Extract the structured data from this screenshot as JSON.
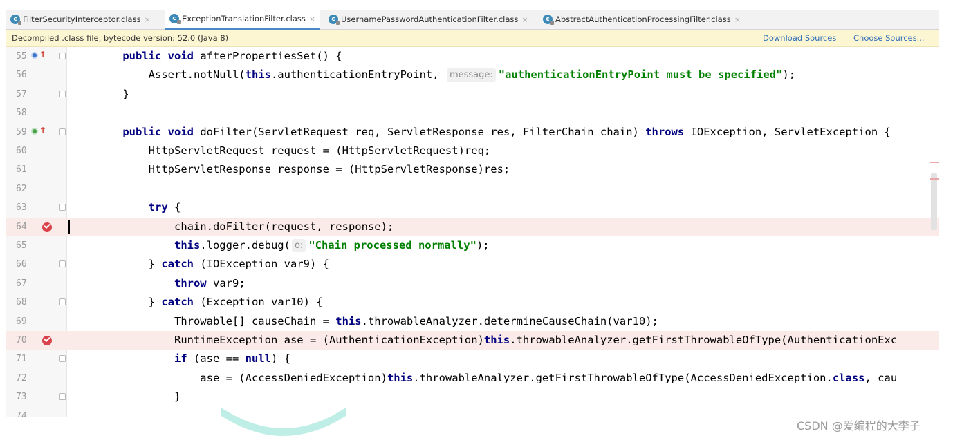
{
  "tabs": [
    {
      "label": "FilterSecurityInterceptor.class",
      "active": false
    },
    {
      "label": "ExceptionTranslationFilter.class",
      "active": true
    },
    {
      "label": "UsernamePasswordAuthenticationFilter.class",
      "active": false
    },
    {
      "label": "AbstractAuthenticationProcessingFilter.class",
      "active": false
    }
  ],
  "tab_icon_letter": "c",
  "close_glyph": "×",
  "banner": {
    "text": "Decompiled .class file, bytecode version: 52.0 (Java 8)",
    "download_link": "Download Sources",
    "choose_link": "Choose Sources..."
  },
  "code_lines": [
    {
      "n": "55",
      "marker": "override-blue",
      "tokens": [
        {
          "t": "    "
        },
        {
          "t": "public void",
          "c": "kw"
        },
        {
          "t": " afterPropertiesSet() {"
        }
      ]
    },
    {
      "n": "56",
      "tokens": [
        {
          "t": "        Assert.notNull("
        },
        {
          "t": "this",
          "c": "kw"
        },
        {
          "t": ".authenticationEntryPoint, "
        },
        {
          "t": "message:",
          "c": "hint"
        },
        {
          "t": "\"authenticationEntryPoint must be specified\"",
          "c": "str"
        },
        {
          "t": ");"
        }
      ]
    },
    {
      "n": "57",
      "tokens": [
        {
          "t": "    }"
        }
      ]
    },
    {
      "n": "58",
      "tokens": []
    },
    {
      "n": "59",
      "marker": "override-green",
      "tokens": [
        {
          "t": "    "
        },
        {
          "t": "public void",
          "c": "kw"
        },
        {
          "t": " doFilter(ServletRequest req, ServletResponse res, FilterChain chain) "
        },
        {
          "t": "throws",
          "c": "kw"
        },
        {
          "t": " IOException, ServletException {"
        }
      ]
    },
    {
      "n": "60",
      "tokens": [
        {
          "t": "        HttpServletRequest request = (HttpServletRequest)req;"
        }
      ]
    },
    {
      "n": "61",
      "tokens": [
        {
          "t": "        HttpServletResponse response = (HttpServletResponse)res;"
        }
      ]
    },
    {
      "n": "62",
      "tokens": []
    },
    {
      "n": "63",
      "tokens": [
        {
          "t": "        "
        },
        {
          "t": "try",
          "c": "kw"
        },
        {
          "t": " {"
        }
      ]
    },
    {
      "n": "64",
      "marker": "breakpoint",
      "highlight": true,
      "caret": true,
      "tokens": [
        {
          "t": "            chain.doFilter(request, response);"
        }
      ]
    },
    {
      "n": "65",
      "tokens": [
        {
          "t": "            "
        },
        {
          "t": "this",
          "c": "kw"
        },
        {
          "t": ".logger.debug("
        },
        {
          "t": "o:",
          "c": "hint"
        },
        {
          "t": "\"Chain processed normally\"",
          "c": "str"
        },
        {
          "t": ");"
        }
      ]
    },
    {
      "n": "66",
      "tokens": [
        {
          "t": "        } "
        },
        {
          "t": "catch",
          "c": "kw"
        },
        {
          "t": " (IOException var9) {"
        }
      ]
    },
    {
      "n": "67",
      "tokens": [
        {
          "t": "            "
        },
        {
          "t": "throw",
          "c": "kw"
        },
        {
          "t": " var9;"
        }
      ]
    },
    {
      "n": "68",
      "tokens": [
        {
          "t": "        } "
        },
        {
          "t": "catch",
          "c": "kw"
        },
        {
          "t": " (Exception var10) {"
        }
      ]
    },
    {
      "n": "69",
      "tokens": [
        {
          "t": "            Throwable[] causeChain = "
        },
        {
          "t": "this",
          "c": "kw"
        },
        {
          "t": ".throwableAnalyzer.determineCauseChain(var10);"
        }
      ]
    },
    {
      "n": "70",
      "marker": "breakpoint",
      "highlight": true,
      "tokens": [
        {
          "t": "            RuntimeException ase = (AuthenticationException)"
        },
        {
          "t": "this",
          "c": "kw"
        },
        {
          "t": ".throwableAnalyzer.getFirstThrowableOfType(AuthenticationExc"
        }
      ]
    },
    {
      "n": "71",
      "tokens": [
        {
          "t": "            "
        },
        {
          "t": "if",
          "c": "kw"
        },
        {
          "t": " (ase == "
        },
        {
          "t": "null",
          "c": "kw"
        },
        {
          "t": ") {"
        }
      ]
    },
    {
      "n": "72",
      "tokens": [
        {
          "t": "                ase = (AccessDeniedException)"
        },
        {
          "t": "this",
          "c": "kw"
        },
        {
          "t": ".throwableAnalyzer.getFirstThrowableOfType(AccessDeniedException."
        },
        {
          "t": "class",
          "c": "kw"
        },
        {
          "t": ", cau"
        }
      ]
    },
    {
      "n": "73",
      "tokens": [
        {
          "t": "            }"
        }
      ]
    },
    {
      "n": "74",
      "tokens": []
    }
  ],
  "watermark": "CSDN @爱编程的大李子",
  "colors": {
    "keyword": "#000080",
    "string": "#008000",
    "highlight": "#faeae8",
    "breakpoint": "#d9424b",
    "link": "#2f6fb9"
  }
}
